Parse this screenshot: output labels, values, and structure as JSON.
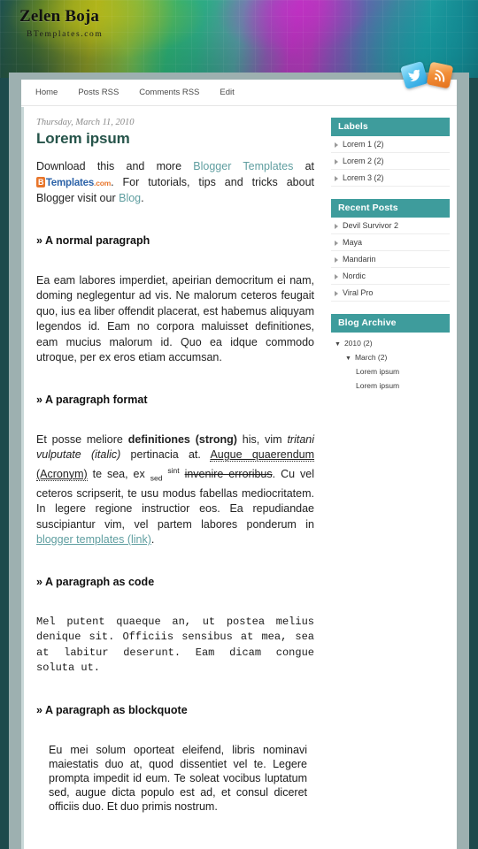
{
  "header": {
    "blog_title": "Zelen Boja",
    "blog_description": "BTemplates.com",
    "social": [
      {
        "name": "twitter-icon",
        "label": "Twitter"
      },
      {
        "name": "rss-icon",
        "label": "RSS"
      }
    ]
  },
  "nav": {
    "items": [
      {
        "label": "Home"
      },
      {
        "label": "Posts RSS"
      },
      {
        "label": "Comments RSS"
      },
      {
        "label": "Edit"
      }
    ]
  },
  "post": {
    "date": "Thursday, March 11, 2010",
    "title": "Lorem ipsum",
    "intro": {
      "part1": "Download this and more ",
      "link1": "Blogger Templates",
      "part2": " at ",
      "logo_b": "B",
      "logo_templates": "Templates",
      "logo_com": ".com",
      "part3": ". For tutorials, tips and tricks about Blogger visit our ",
      "link2": "Blog",
      "part4": "."
    },
    "sections": [
      {
        "heading": "» A normal paragraph"
      },
      {
        "heading": "» A paragraph format"
      },
      {
        "heading": "» A paragraph as code"
      },
      {
        "heading": "» A paragraph as blockquote"
      }
    ],
    "normal_paragraph": "Ea eam labores imperdiet, apeirian democritum ei nam, doming neglegentur ad vis. Ne malorum ceteros feugait quo, ius ea liber offendit placerat, est habemus aliquyam legendos id. Eam no corpora maluisset definitiones, eam mucius malorum id. Quo ea idque commodo utroque, per ex eros etiam accumsan.",
    "format_paragraph": {
      "p1": "Et posse meliore ",
      "strong": "definitiones (strong)",
      "p2": " his, vim ",
      "italic": "tritani vulputate (italic)",
      "p3": " pertinacia at. ",
      "acronym": "Augue quaerendum (Acronym)",
      "p4": " te sea, ex ",
      "sub": "sed",
      "p5": " ",
      "sup": "sint",
      "p6": " ",
      "del": "invenire erroribus",
      "p7": ". Cu vel ceteros scripserit, te usu modus fabellas mediocritatem. In legere regione instructior eos. Ea repudiandae suscipiantur vim, vel partem labores ponderum in ",
      "link": "blogger templates (link)",
      "p8": "."
    },
    "code_paragraph": "Mel putent quaeque an, ut postea melius denique sit. Officiis sensibus at mea, sea at labitur deserunt. Eam dicam congue soluta ut.",
    "blockquote_paragraph": "Eu mei solum oporteat eleifend, libris nominavi maiestatis duo at, quod dissentiet vel te. Legere prompta impedit id eum. Te soleat vocibus luptatum sed, augue dicta populo est ad, et consul diceret officiis duo. Et duo primis nostrum."
  },
  "sidebar": {
    "widgets": [
      {
        "title": "Labels",
        "type": "list",
        "items": [
          {
            "label": "Lorem 1 (2)"
          },
          {
            "label": "Lorem 2 (2)"
          },
          {
            "label": "Lorem 3 (2)"
          }
        ]
      },
      {
        "title": "Recent Posts",
        "type": "list",
        "items": [
          {
            "label": "Devil Survivor 2"
          },
          {
            "label": "Maya"
          },
          {
            "label": "Mandarin"
          },
          {
            "label": "Nordic"
          },
          {
            "label": "Viral Pro"
          }
        ]
      },
      {
        "title": "Blog Archive",
        "type": "archive",
        "tree": [
          {
            "level": 1,
            "marker": "▼",
            "label": "2010 (2)"
          },
          {
            "level": 2,
            "marker": "▼",
            "label": "March (2)"
          },
          {
            "level": 3,
            "marker": "",
            "label": "Lorem ipsum"
          },
          {
            "level": 3,
            "marker": "",
            "label": "Lorem ipsum"
          }
        ]
      }
    ]
  },
  "colors": {
    "accent_teal": "#3e9c9c",
    "title_green": "#26544a",
    "link_teal": "#5f9ea0",
    "frame_dark": "#1d4a4c",
    "frame_gray": "#9db0b0",
    "logo_orange": "#e8762c",
    "logo_blue": "#2d63a8"
  }
}
